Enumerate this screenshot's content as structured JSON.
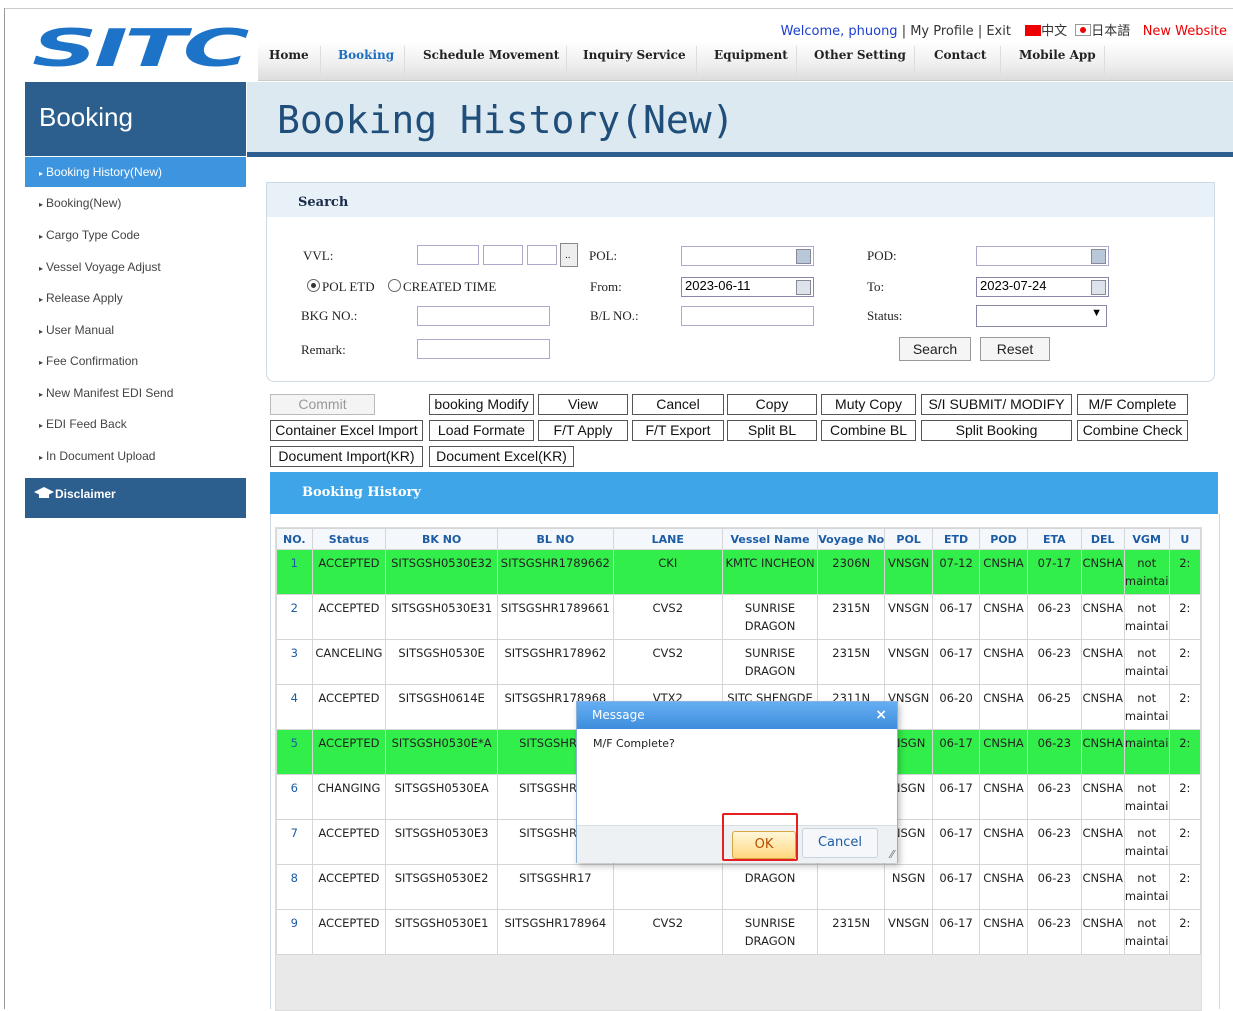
{
  "logo": "SITC",
  "topbar": {
    "welcome": "Welcome, phuong",
    "sep1": " | ",
    "profile": "My Profile",
    "sep2": " | ",
    "exit": "Exit",
    "lang_cn": "中文",
    "lang_jp": "日本語",
    "new_website": "New Website"
  },
  "nav": {
    "items": [
      "Home",
      "Booking",
      "Schedule Movement",
      "Inquiry Service",
      "Equipment",
      "Other Setting",
      "Contact",
      "Mobile App"
    ]
  },
  "sidebar": {
    "title": "Booking",
    "items": [
      "Booking History(New)",
      "Booking(New)",
      "Cargo Type Code",
      "Vessel Voyage Adjust",
      "Release Apply",
      "User Manual",
      "Fee Confirmation",
      "New Manifest EDI Send",
      "EDI Feed Back",
      "In Document Upload"
    ],
    "disclaimer": "Disclaimer"
  },
  "page": {
    "title": "Booking History(New)"
  },
  "search": {
    "title": "Search",
    "vvl_label": "VVL:",
    "vvl_btn": "..",
    "pol_label": "POL:",
    "pod_label": "POD:",
    "radio_pol_etd": "POL ETD",
    "radio_created": "CREATED TIME",
    "from_label": "From:",
    "from_value": "2023-06-11",
    "to_label": "To:",
    "to_value": "2023-07-24",
    "bkg_label": "BKG NO.:",
    "bl_label": "B/L NO.:",
    "status_label": "Status:",
    "remark_label": "Remark:",
    "search_btn": "Search",
    "reset_btn": "Reset"
  },
  "actions": {
    "row1": [
      "Commit",
      "booking Modify",
      "View",
      "Cancel",
      "Copy",
      "Muty Copy",
      "S/I SUBMIT/ MODIFY",
      "M/F Complete"
    ],
    "row2": [
      "Container Excel Import",
      "Load Formate",
      "F/T Apply",
      "F/T Export",
      "Split BL",
      "Combine BL",
      "Split Booking",
      "Combine Check"
    ],
    "row3": [
      "Document Import(KR)",
      "Document Excel(KR)"
    ]
  },
  "history": {
    "title": "Booking History",
    "columns": [
      "NO.",
      "Status",
      "BK NO",
      "BL NO",
      "LANE",
      "Vessel Name",
      "Voyage No",
      "POL",
      "ETD",
      "POD",
      "ETA",
      "DEL",
      "VGM",
      "U"
    ],
    "rows": [
      {
        "no": "1",
        "status": "ACCEPTED",
        "bk": "SITSGSH0530E32",
        "bl": "SITSGSHR1789662",
        "lane": "CKI",
        "vessel": "KMTC INCHEON",
        "voy": "2306N",
        "pol": "VNSGN",
        "etd": "07-12",
        "pod": "CNSHA",
        "eta": "07-17",
        "del": "CNSHA",
        "vgm": "not maintai",
        "u": "2:",
        "hl": true
      },
      {
        "no": "2",
        "status": "ACCEPTED",
        "bk": "SITSGSH0530E31",
        "bl": "SITSGSHR1789661",
        "lane": "CVS2",
        "vessel": "SUNRISE DRAGON",
        "voy": "2315N",
        "pol": "VNSGN",
        "etd": "06-17",
        "pod": "CNSHA",
        "eta": "06-23",
        "del": "CNSHA",
        "vgm": "not maintai",
        "u": "2:",
        "hl": false
      },
      {
        "no": "3",
        "status": "CANCELING",
        "bk": "SITSGSH0530E",
        "bl": "SITSGSHR178962",
        "lane": "CVS2",
        "vessel": "SUNRISE DRAGON",
        "voy": "2315N",
        "pol": "VNSGN",
        "etd": "06-17",
        "pod": "CNSHA",
        "eta": "06-23",
        "del": "CNSHA",
        "vgm": "not maintai",
        "u": "2:",
        "hl": false
      },
      {
        "no": "4",
        "status": "ACCEPTED",
        "bk": "SITSGSH0614E",
        "bl": "SITSGSHR178968",
        "lane": "VTX2",
        "vessel": "SITC SHENGDE",
        "voy": "2311N",
        "pol": "VNSGN",
        "etd": "06-20",
        "pod": "CNSHA",
        "eta": "06-25",
        "del": "CNSHA",
        "vgm": "not maintai",
        "u": "2:",
        "hl": false
      },
      {
        "no": "5",
        "status": "ACCEPTED",
        "bk": "SITSGSH0530E*A",
        "bl": "SITSGSHR17",
        "lane": "",
        "vessel": "",
        "voy": "",
        "pol": "NSGN",
        "etd": "06-17",
        "pod": "CNSHA",
        "eta": "06-23",
        "del": "CNSHA",
        "vgm": "maintai",
        "u": "2:",
        "hl": true
      },
      {
        "no": "6",
        "status": "CHANGING",
        "bk": "SITSGSH0530EA",
        "bl": "SITSGSHR17",
        "lane": "",
        "vessel": "",
        "voy": "",
        "pol": "NSGN",
        "etd": "06-17",
        "pod": "CNSHA",
        "eta": "06-23",
        "del": "CNSHA",
        "vgm": "not maintai",
        "u": "2:",
        "hl": false
      },
      {
        "no": "7",
        "status": "ACCEPTED",
        "bk": "SITSGSH0530E3",
        "bl": "SITSGSHR17",
        "lane": "",
        "vessel": "",
        "voy": "",
        "pol": "NSGN",
        "etd": "06-17",
        "pod": "CNSHA",
        "eta": "06-23",
        "del": "CNSHA",
        "vgm": "not maintai",
        "u": "2:",
        "hl": false
      },
      {
        "no": "8",
        "status": "ACCEPTED",
        "bk": "SITSGSH0530E2",
        "bl": "SITSGSHR17",
        "lane": "",
        "vessel": "DRAGON",
        "voy": "",
        "pol": "NSGN",
        "etd": "06-17",
        "pod": "CNSHA",
        "eta": "06-23",
        "del": "CNSHA",
        "vgm": "not maintai",
        "u": "2:",
        "hl": false
      },
      {
        "no": "9",
        "status": "ACCEPTED",
        "bk": "SITSGSH0530E1",
        "bl": "SITSGSHR178964",
        "lane": "CVS2",
        "vessel": "SUNRISE DRAGON",
        "voy": "2315N",
        "pol": "VNSGN",
        "etd": "06-17",
        "pod": "CNSHA",
        "eta": "06-23",
        "del": "CNSHA",
        "vgm": "not maintai",
        "u": "2:",
        "hl": false
      }
    ]
  },
  "dialog": {
    "title": "Message",
    "close": "×",
    "message": "M/F Complete?",
    "ok": "OK",
    "cancel": "Cancel"
  },
  "colors": {
    "brand": "#1d6fc1",
    "sidebar": "#2c5f8e",
    "active": "#3d95df",
    "highlight_row": "#32ee4a",
    "alert": "#e52020"
  }
}
